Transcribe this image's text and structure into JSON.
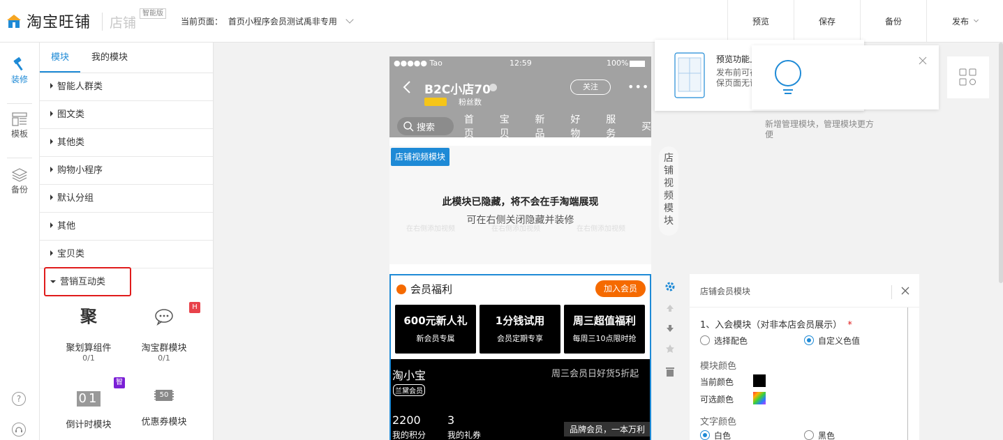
{
  "header": {
    "logo_text": "淘宝旺铺",
    "shop_label": "店铺",
    "edition_badge": "智能版",
    "current_page_label": "当前页面：",
    "current_page_value": "首页小程序会员测试禹非专用",
    "actions": {
      "preview": "预览",
      "save": "保存",
      "backup": "备份",
      "publish": "发布"
    }
  },
  "rail": {
    "decorate": "装修",
    "template": "模板",
    "backup": "备份",
    "help": "?"
  },
  "panel": {
    "tabs": [
      "模块",
      "我的模块"
    ],
    "categories": [
      "智能人群类",
      "图文类",
      "其他类",
      "购物小程序",
      "默认分组",
      "其他",
      "宝贝类"
    ],
    "open_category": "营销互动类",
    "modules": [
      {
        "icon_text": "聚",
        "name": "聚划算组件",
        "count": "0/1"
      },
      {
        "icon_text": "",
        "name": "淘宝群模块",
        "count": "0/1",
        "badge": "H"
      },
      {
        "icon_text": "01",
        "name": "倒计时模块",
        "count": "",
        "badge": "智"
      },
      {
        "icon_text": "50",
        "name": "优惠券模块",
        "count": ""
      }
    ]
  },
  "phone": {
    "status": {
      "carrier": "●●●●● Tao",
      "time": "12:59",
      "battery": "100%"
    },
    "shop_title": "B2C小店70",
    "fans_label": "粉丝数",
    "follow_label": "关注",
    "search_placeholder": "搜索",
    "nav": [
      "首页",
      "宝贝",
      "新品",
      "好物",
      "服务",
      "买"
    ],
    "video_module_tag": "店铺视频模块",
    "hidden_title": "此模块已隐藏，将不会在手淘端展现",
    "hidden_sub": "可在右侧关闭隐藏并装修",
    "ghost_texts": [
      "在右侧添加视频",
      "在右侧添加视频",
      "在右侧添加视频"
    ],
    "member": {
      "title": "会员福利",
      "join_label": "加入会员",
      "cards": [
        {
          "title": "600元新人礼",
          "sub": "新会员专属"
        },
        {
          "title": "1分钱试用",
          "sub": "会员定期专享"
        },
        {
          "title": "周三超值福利",
          "sub": "每周三10点限时抢"
        }
      ],
      "brand_name": "淘小宝",
      "brand_tag": "兰黛会员",
      "promo": "周三会员日好货5折起",
      "points_value": "2200",
      "points_label": "我的积分",
      "coupons_value": "3",
      "coupons_label": "我的礼券",
      "brand_slogan": "品牌会员，一本万利"
    }
  },
  "side_label": "店铺视频模块",
  "tooltip": {
    "title": "预览功能上线",
    "desc_line1": "发布前可在",
    "desc_line2": "保页面无误",
    "manage_text": "新增管理模块，管理模块更方便"
  },
  "form": {
    "title": "店铺会员模块",
    "section1": "1、入会模块（对非本店会员展示）",
    "required_mark": "*",
    "option_palette": "选择配色",
    "option_custom": "自定义色值",
    "module_color_label": "模块颜色",
    "current_color_label": "当前颜色",
    "optional_color_label": "可选颜色",
    "text_color_label": "文字颜色",
    "white_label": "白色",
    "black_label": "黑色",
    "current_color": "#000000",
    "accent": "#1e8ad6"
  }
}
